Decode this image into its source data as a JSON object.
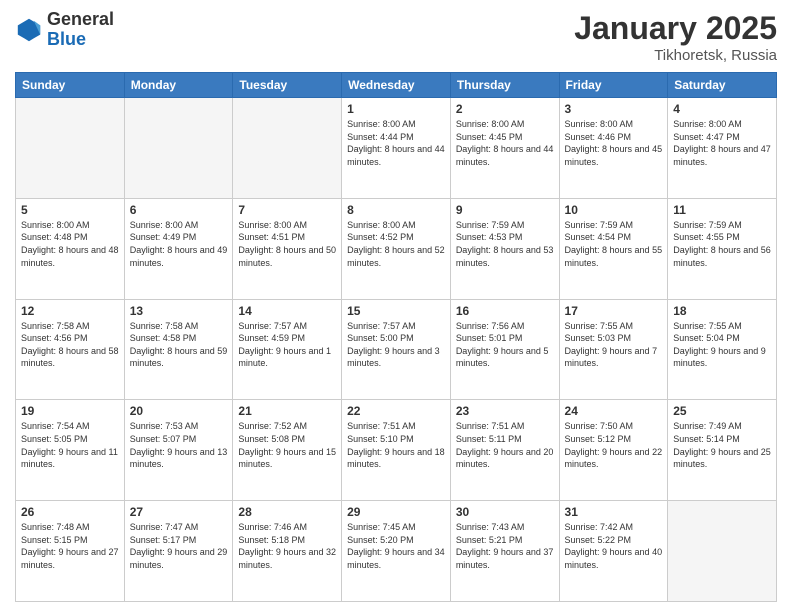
{
  "header": {
    "logo_general": "General",
    "logo_blue": "Blue",
    "month_year": "January 2025",
    "location": "Tikhoretsk, Russia"
  },
  "days_of_week": [
    "Sunday",
    "Monday",
    "Tuesday",
    "Wednesday",
    "Thursday",
    "Friday",
    "Saturday"
  ],
  "weeks": [
    [
      {
        "day": "",
        "info": ""
      },
      {
        "day": "",
        "info": ""
      },
      {
        "day": "",
        "info": ""
      },
      {
        "day": "1",
        "info": "Sunrise: 8:00 AM\nSunset: 4:44 PM\nDaylight: 8 hours\nand 44 minutes."
      },
      {
        "day": "2",
        "info": "Sunrise: 8:00 AM\nSunset: 4:45 PM\nDaylight: 8 hours\nand 44 minutes."
      },
      {
        "day": "3",
        "info": "Sunrise: 8:00 AM\nSunset: 4:46 PM\nDaylight: 8 hours\nand 45 minutes."
      },
      {
        "day": "4",
        "info": "Sunrise: 8:00 AM\nSunset: 4:47 PM\nDaylight: 8 hours\nand 47 minutes."
      }
    ],
    [
      {
        "day": "5",
        "info": "Sunrise: 8:00 AM\nSunset: 4:48 PM\nDaylight: 8 hours\nand 48 minutes."
      },
      {
        "day": "6",
        "info": "Sunrise: 8:00 AM\nSunset: 4:49 PM\nDaylight: 8 hours\nand 49 minutes."
      },
      {
        "day": "7",
        "info": "Sunrise: 8:00 AM\nSunset: 4:51 PM\nDaylight: 8 hours\nand 50 minutes."
      },
      {
        "day": "8",
        "info": "Sunrise: 8:00 AM\nSunset: 4:52 PM\nDaylight: 8 hours\nand 52 minutes."
      },
      {
        "day": "9",
        "info": "Sunrise: 7:59 AM\nSunset: 4:53 PM\nDaylight: 8 hours\nand 53 minutes."
      },
      {
        "day": "10",
        "info": "Sunrise: 7:59 AM\nSunset: 4:54 PM\nDaylight: 8 hours\nand 55 minutes."
      },
      {
        "day": "11",
        "info": "Sunrise: 7:59 AM\nSunset: 4:55 PM\nDaylight: 8 hours\nand 56 minutes."
      }
    ],
    [
      {
        "day": "12",
        "info": "Sunrise: 7:58 AM\nSunset: 4:56 PM\nDaylight: 8 hours\nand 58 minutes."
      },
      {
        "day": "13",
        "info": "Sunrise: 7:58 AM\nSunset: 4:58 PM\nDaylight: 8 hours\nand 59 minutes."
      },
      {
        "day": "14",
        "info": "Sunrise: 7:57 AM\nSunset: 4:59 PM\nDaylight: 9 hours\nand 1 minute."
      },
      {
        "day": "15",
        "info": "Sunrise: 7:57 AM\nSunset: 5:00 PM\nDaylight: 9 hours\nand 3 minutes."
      },
      {
        "day": "16",
        "info": "Sunrise: 7:56 AM\nSunset: 5:01 PM\nDaylight: 9 hours\nand 5 minutes."
      },
      {
        "day": "17",
        "info": "Sunrise: 7:55 AM\nSunset: 5:03 PM\nDaylight: 9 hours\nand 7 minutes."
      },
      {
        "day": "18",
        "info": "Sunrise: 7:55 AM\nSunset: 5:04 PM\nDaylight: 9 hours\nand 9 minutes."
      }
    ],
    [
      {
        "day": "19",
        "info": "Sunrise: 7:54 AM\nSunset: 5:05 PM\nDaylight: 9 hours\nand 11 minutes."
      },
      {
        "day": "20",
        "info": "Sunrise: 7:53 AM\nSunset: 5:07 PM\nDaylight: 9 hours\nand 13 minutes."
      },
      {
        "day": "21",
        "info": "Sunrise: 7:52 AM\nSunset: 5:08 PM\nDaylight: 9 hours\nand 15 minutes."
      },
      {
        "day": "22",
        "info": "Sunrise: 7:51 AM\nSunset: 5:10 PM\nDaylight: 9 hours\nand 18 minutes."
      },
      {
        "day": "23",
        "info": "Sunrise: 7:51 AM\nSunset: 5:11 PM\nDaylight: 9 hours\nand 20 minutes."
      },
      {
        "day": "24",
        "info": "Sunrise: 7:50 AM\nSunset: 5:12 PM\nDaylight: 9 hours\nand 22 minutes."
      },
      {
        "day": "25",
        "info": "Sunrise: 7:49 AM\nSunset: 5:14 PM\nDaylight: 9 hours\nand 25 minutes."
      }
    ],
    [
      {
        "day": "26",
        "info": "Sunrise: 7:48 AM\nSunset: 5:15 PM\nDaylight: 9 hours\nand 27 minutes."
      },
      {
        "day": "27",
        "info": "Sunrise: 7:47 AM\nSunset: 5:17 PM\nDaylight: 9 hours\nand 29 minutes."
      },
      {
        "day": "28",
        "info": "Sunrise: 7:46 AM\nSunset: 5:18 PM\nDaylight: 9 hours\nand 32 minutes."
      },
      {
        "day": "29",
        "info": "Sunrise: 7:45 AM\nSunset: 5:20 PM\nDaylight: 9 hours\nand 34 minutes."
      },
      {
        "day": "30",
        "info": "Sunrise: 7:43 AM\nSunset: 5:21 PM\nDaylight: 9 hours\nand 37 minutes."
      },
      {
        "day": "31",
        "info": "Sunrise: 7:42 AM\nSunset: 5:22 PM\nDaylight: 9 hours\nand 40 minutes."
      },
      {
        "day": "",
        "info": ""
      }
    ]
  ]
}
